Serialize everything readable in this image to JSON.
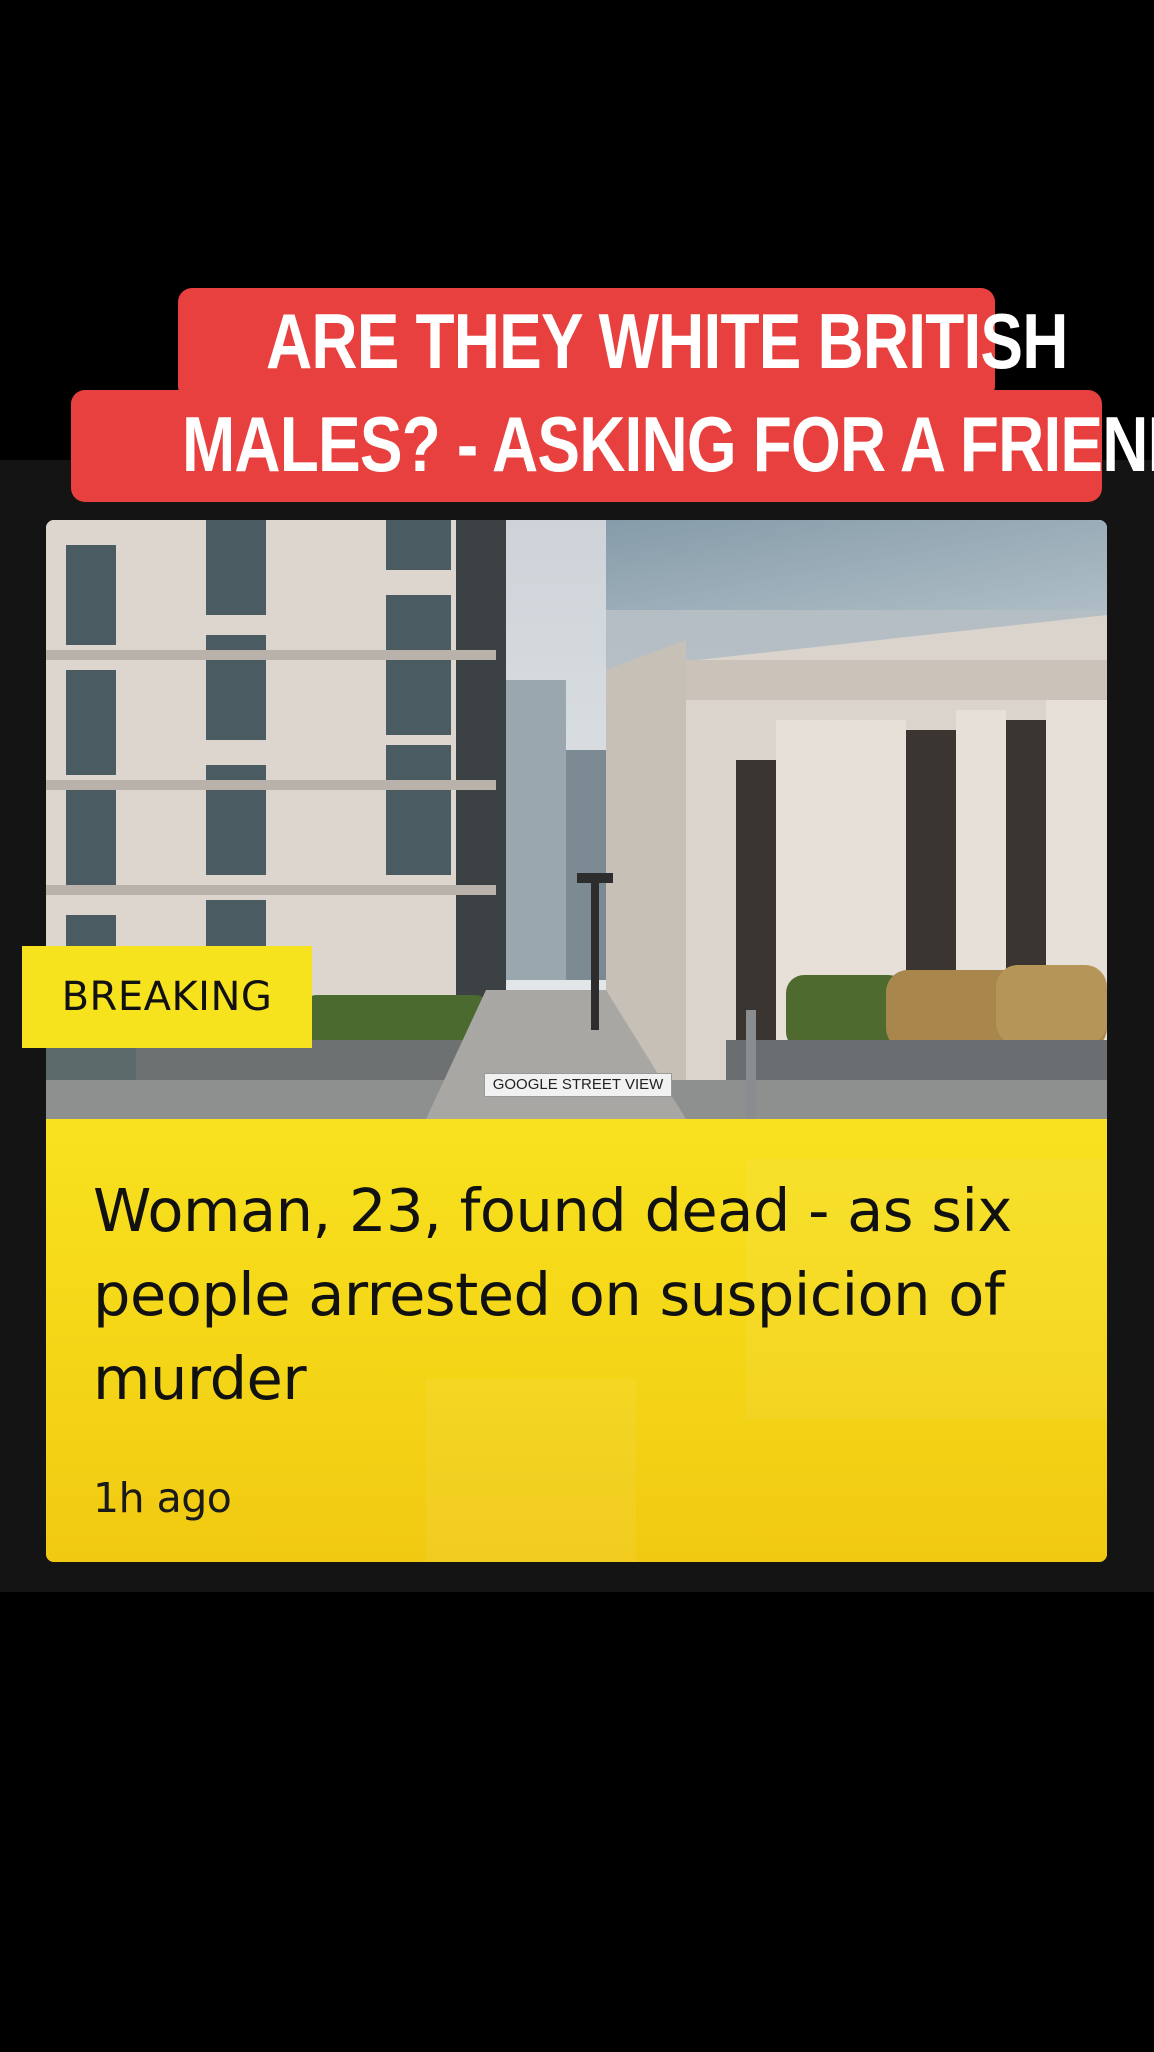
{
  "caption": {
    "line1": "ARE THEY WHITE BRITISH",
    "line2": "MALES? - ASKING FOR A FRIEND"
  },
  "article": {
    "badge": "BREAKING",
    "image_credit": "GOOGLE STREET VIEW",
    "headline": "Woman, 23, found dead - as six people arrested on suspicion of murder",
    "timestamp": "1h ago"
  },
  "colors": {
    "caption_bg": "#e8403f",
    "breaking_yellow": "#f6e21d",
    "card_yellow": "#f6d317"
  }
}
